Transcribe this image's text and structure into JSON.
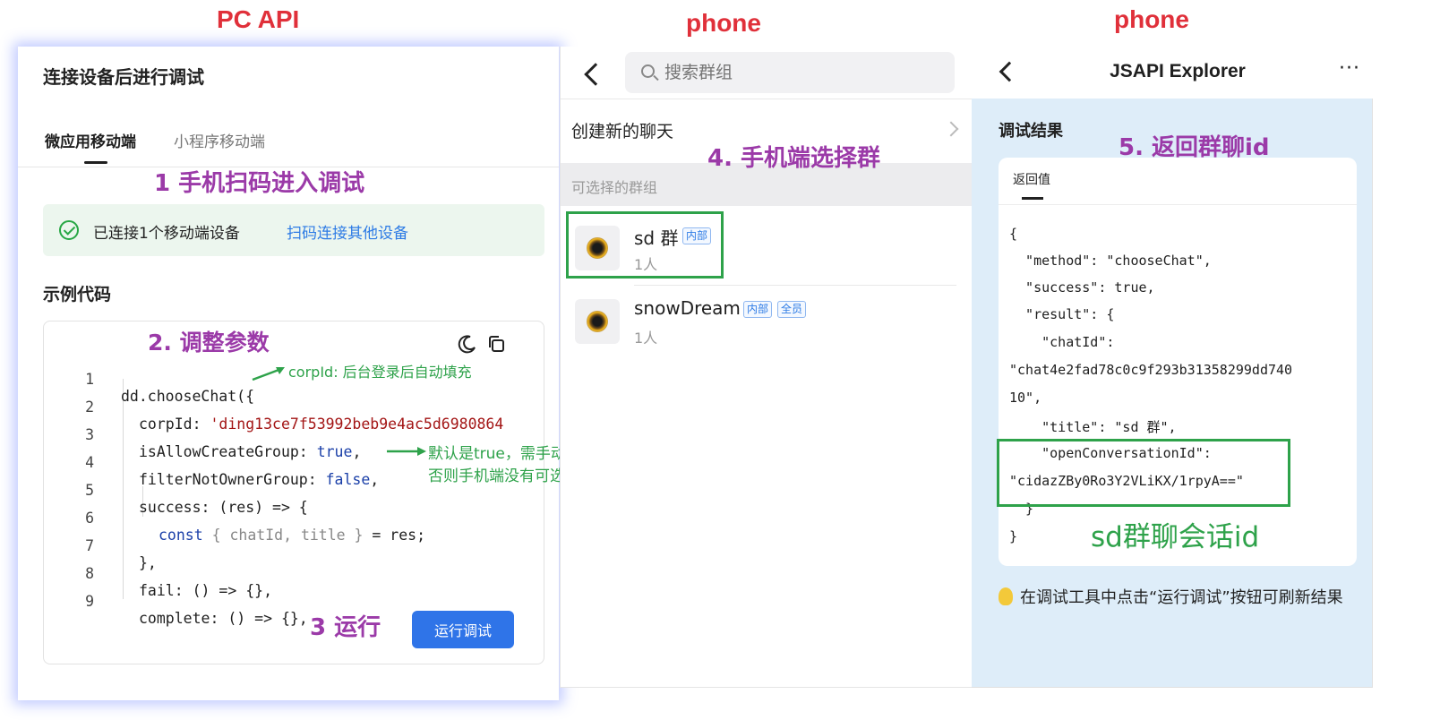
{
  "section_titles": {
    "pc": "PC API",
    "phone1": "phone",
    "phone2": "phone"
  },
  "pc": {
    "title": "连接设备后进行调试",
    "tabs": [
      {
        "label": "微应用移动端",
        "active": true
      },
      {
        "label": "小程序移动端",
        "active": false
      }
    ],
    "step1": "1 手机扫码进入调试",
    "status_text": "已连接1个移动端设备",
    "status_link": "扫码连接其他设备",
    "sample_title": "示例代码",
    "step2": "2. 调整参数",
    "code": {
      "line_numbers": [
        "1",
        "2",
        "3",
        "4",
        "5",
        "6",
        "7",
        "8",
        "9"
      ],
      "l1": "dd.chooseChat({",
      "l2_key": "corpId: ",
      "l2_val": "'ding13ce7f53992beb9e4ac5d6980864",
      "l3_key": "isAllowCreateGroup: ",
      "l3_val": "true",
      "l3_end": ",",
      "l4_key": "filterNotOwnerGroup: ",
      "l4_val": "false",
      "l4_end": ",",
      "l5": "success: (res) => {",
      "l6_kw": "const",
      "l6_mid": " { chatId, title } ",
      "l6_end": "= res;",
      "l7": "},",
      "l8": "fail: () => {},",
      "l9": "complete: () => {},"
    },
    "corpid_note": "corpId: 后台登录后自动填充",
    "filter_note_1": "默认是true，需手动改为false",
    "filter_note_2": "否则手机端没有可选群聊",
    "step3": "3 运行",
    "run_button": "运行调试",
    "icons": [
      "moon-icon",
      "copy-icon"
    ]
  },
  "phone1": {
    "search_placeholder": "搜索群组",
    "new_chat": "创建新的聊天",
    "group_header": "可选择的群组",
    "step4": "4. 手机端选择群",
    "groups": [
      {
        "name": "sd 群",
        "count": "1人",
        "tags": [
          "内部"
        ]
      },
      {
        "name": "snowDream",
        "count": "1人",
        "tags": [
          "内部",
          "全员"
        ]
      }
    ]
  },
  "phone2": {
    "title": "JSAPI Explorer",
    "more": "···",
    "result_title": "调试结果",
    "step5": "5. 返回群聊id",
    "tab_label": "返回值",
    "json_lines": [
      "{",
      "  \"method\": \"chooseChat\",",
      "  \"success\": true,",
      "  \"result\": {",
      "    \"chatId\":",
      "\"chat4e2fad78c0c9f293b31358299dd740",
      "10\",",
      "    \"title\": \"sd 群\",",
      "    \"openConversationId\":",
      "\"cidazZBy0Ro3Y2VLiKX/1rpyA==\"",
      "  }",
      "}"
    ],
    "sd_note": "sd群聊会话id",
    "hint": "在调试工具中点击“运行调试”按钮可刷新结果"
  },
  "colors": {
    "section_title": "#e0303a",
    "annotation_purple": "#9b3aa8",
    "annotation_green": "#2ea24a",
    "primary_blue": "#2f74e8"
  }
}
